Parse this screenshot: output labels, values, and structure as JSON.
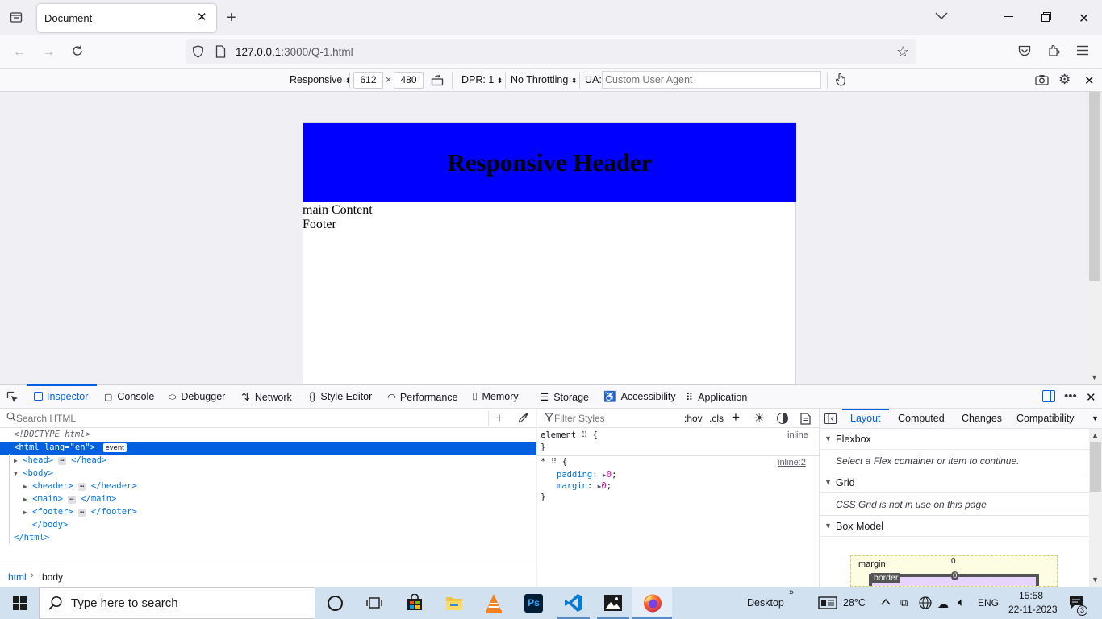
{
  "browser": {
    "tab_title": "Document",
    "url_host": "127.0.0.1",
    "url_rest": ":3000/Q-1.html"
  },
  "rdm": {
    "device": "Responsive",
    "width": "612",
    "times": "×",
    "height": "480",
    "dpr": "DPR: 1",
    "throttling": "No Throttling",
    "ua_label": "UA:",
    "ua_placeholder": "Custom User Agent"
  },
  "page": {
    "header": "Responsive Header",
    "main": "main Content",
    "footer": "Footer"
  },
  "devtools": {
    "tabs": [
      "Inspector",
      "Console",
      "Debugger",
      "Network",
      "Style Editor",
      "Performance",
      "Memory",
      "Storage",
      "Accessibility",
      "Application"
    ],
    "search_placeholder": "Search HTML",
    "filter_placeholder": "Filter Styles",
    "hov": ":hov",
    "cls": ".cls",
    "markup": {
      "doctype": "<!DOCTYPE html>",
      "html_open_tag": "<html",
      "html_attr": "lang",
      "html_eq": "=",
      "html_attr_val": "\"en\"",
      "html_close_bracket": ">",
      "event_badge": "event",
      "head": "<head>",
      "head_close": "</head>",
      "body_open": "<body>",
      "header_open": "<header>",
      "header_close": "</header>",
      "main_open": "<main>",
      "main_close": "</main>",
      "footer_open": "<footer>",
      "footer_close": "</footer>",
      "body_close": "</body>",
      "html_close": "</html>",
      "ellipsis": "⋯"
    },
    "breadcrumbs": [
      "html",
      "body"
    ],
    "rules": {
      "element_selector": "element",
      "element_open": "{",
      "element_source": "inline",
      "element_close": "}",
      "star_selector": "*",
      "star_open": "{",
      "star_source": "inline:2",
      "prop1_name": "padding",
      "prop1_value": "0",
      "prop2_name": "margin",
      "prop2_value": "0",
      "star_close": "}"
    },
    "layout_tabs": [
      "Layout",
      "Computed",
      "Changes",
      "Compatibility"
    ],
    "flexbox_title": "Flexbox",
    "flexbox_msg": "Select a Flex container or item to continue.",
    "grid_title": "Grid",
    "grid_msg": "CSS Grid is not in use on this page",
    "boxmodel_title": "Box Model",
    "bm_margin": "margin",
    "bm_margin_val": "0",
    "bm_border": "border",
    "bm_border_val": "0"
  },
  "taskbar": {
    "search_placeholder": "Type here to search",
    "desktop": "Desktop",
    "chevron": "»",
    "temperature": "28°C",
    "lang": "ENG",
    "time": "15:58",
    "date": "22-11-2023",
    "notif_count": "3"
  },
  "colors": {
    "header_bg": "#0000ff",
    "selected_row": "#0060df",
    "taskbar": "#d2e1f0"
  }
}
